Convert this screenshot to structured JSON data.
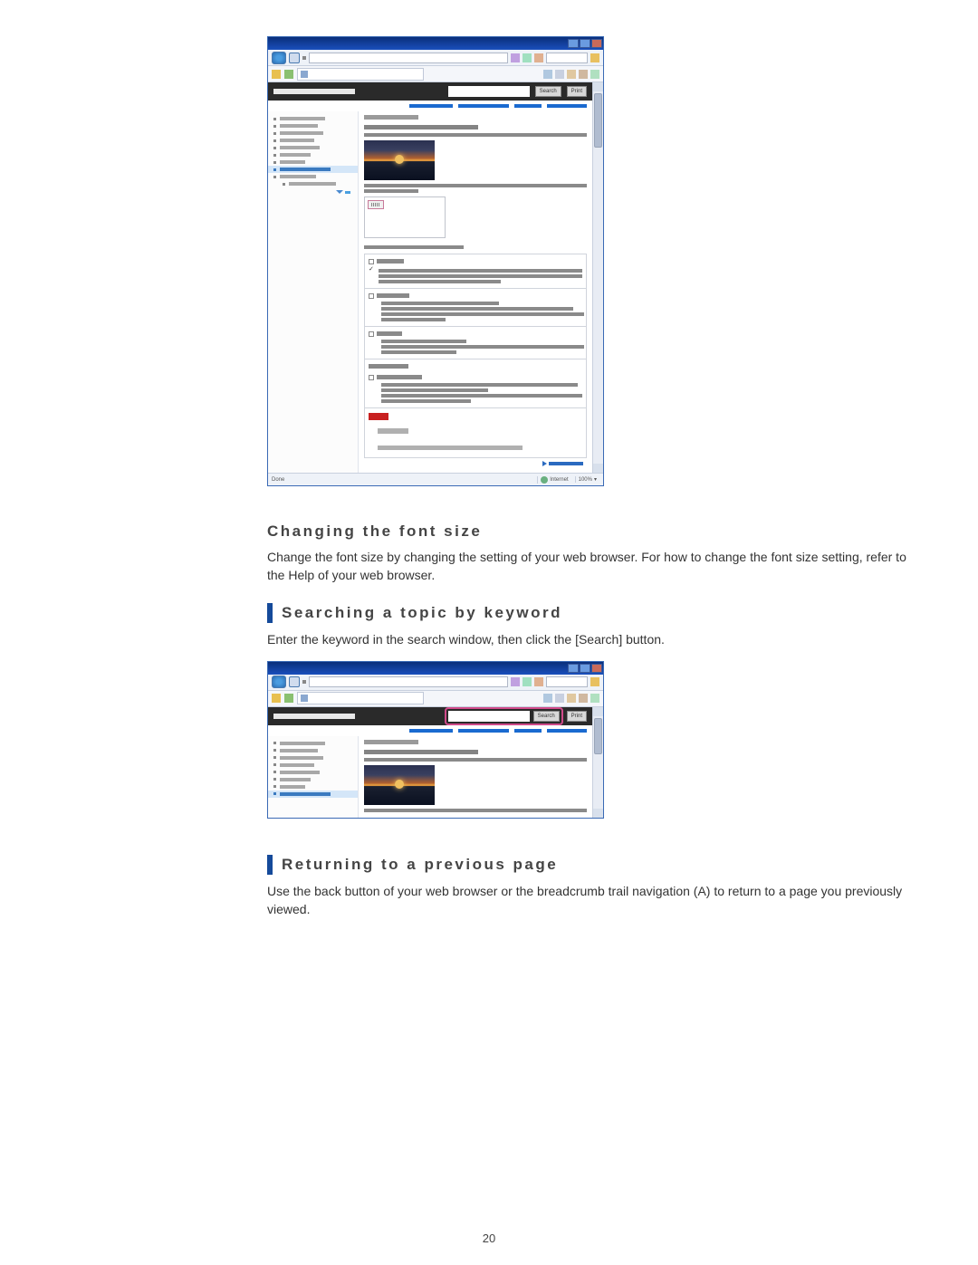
{
  "page_number": "20",
  "sections": {
    "changing_font": {
      "heading": "Changing the font size",
      "body": "Change the font size by changing the setting of your web browser. For how to change the font size setting, refer to the Help of your web browser."
    },
    "searching": {
      "heading": "Searching a topic by keyword",
      "body": "Enter the keyword in the search window, then click the [Search] button."
    },
    "returning": {
      "heading": "Returning to a previous page",
      "body": "Use the back button of your web browser or the breadcrumb trail navigation (A) to return to a page you previously viewed."
    }
  },
  "mock": {
    "search_btn": "Search",
    "print_btn": "Print",
    "status_done": "Done",
    "status_net": "Internet",
    "status_zoom": "100%"
  }
}
